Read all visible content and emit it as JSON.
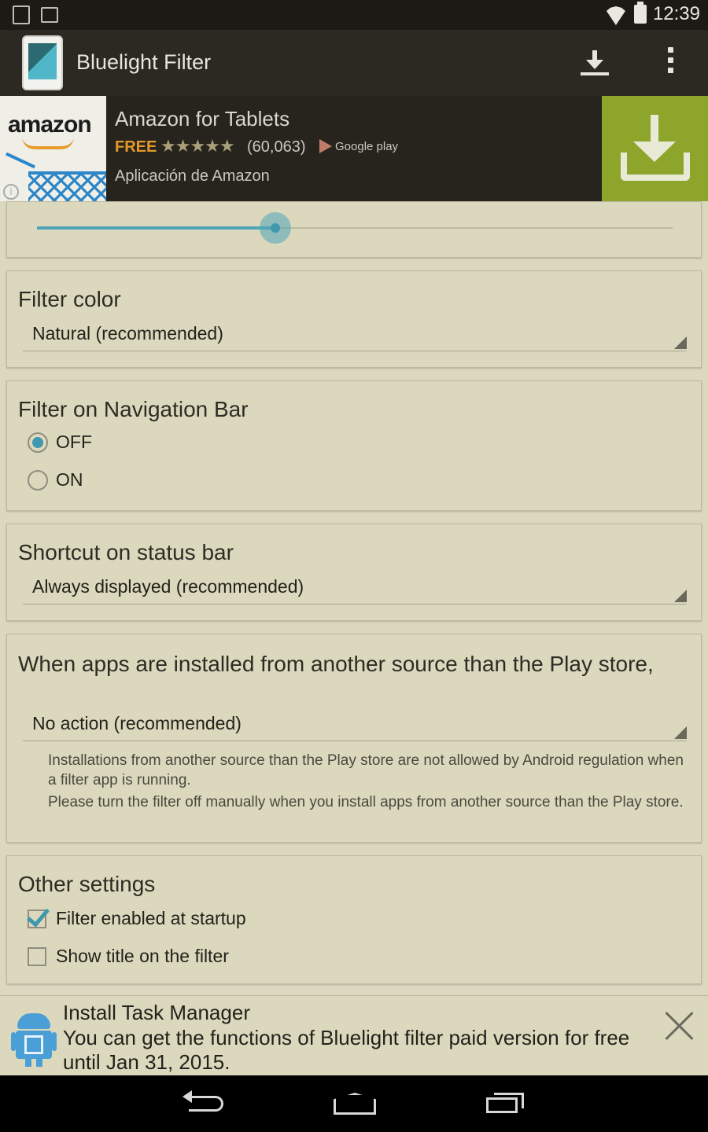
{
  "status_bar": {
    "time": "12:39"
  },
  "action_bar": {
    "title": "Bluelight Filter"
  },
  "ad": {
    "brand": "amazon",
    "title": "Amazon for Tablets",
    "price": "FREE",
    "stars": "★★★★★",
    "rating_count": "(60,063)",
    "store": "Google play",
    "subtitle": "Aplicación de Amazon",
    "info": "i",
    "accent_color": "#8ea52c"
  },
  "opacity_slider": {
    "value_fraction": 0.375,
    "color": "#4ea5b8"
  },
  "filter_color": {
    "title": "Filter color",
    "value": "Natural (recommended)"
  },
  "nav_bar_filter": {
    "title": "Filter on Navigation Bar",
    "options": [
      {
        "label": "OFF",
        "checked": true
      },
      {
        "label": "ON",
        "checked": false
      }
    ]
  },
  "shortcut": {
    "title": "Shortcut on status bar",
    "value": "Always displayed (recommended)"
  },
  "install_source": {
    "title": "When apps are installed from another source than the Play store,",
    "value": "No action (recommended)",
    "note1": "Installations from another source than the Play store are not allowed by Android regulation when a filter app is running.",
    "note2": "Please turn the filter off manually when you install apps from another source than the Play store."
  },
  "other_settings": {
    "title": "Other settings",
    "items": [
      {
        "label": "Filter enabled at startup",
        "checked": true
      },
      {
        "label": "Show title on the filter",
        "checked": false
      }
    ]
  },
  "notification": {
    "title": "Install Task Manager",
    "body": "You can get the functions of Bluelight filter paid version for free until Jan 31, 2015."
  }
}
